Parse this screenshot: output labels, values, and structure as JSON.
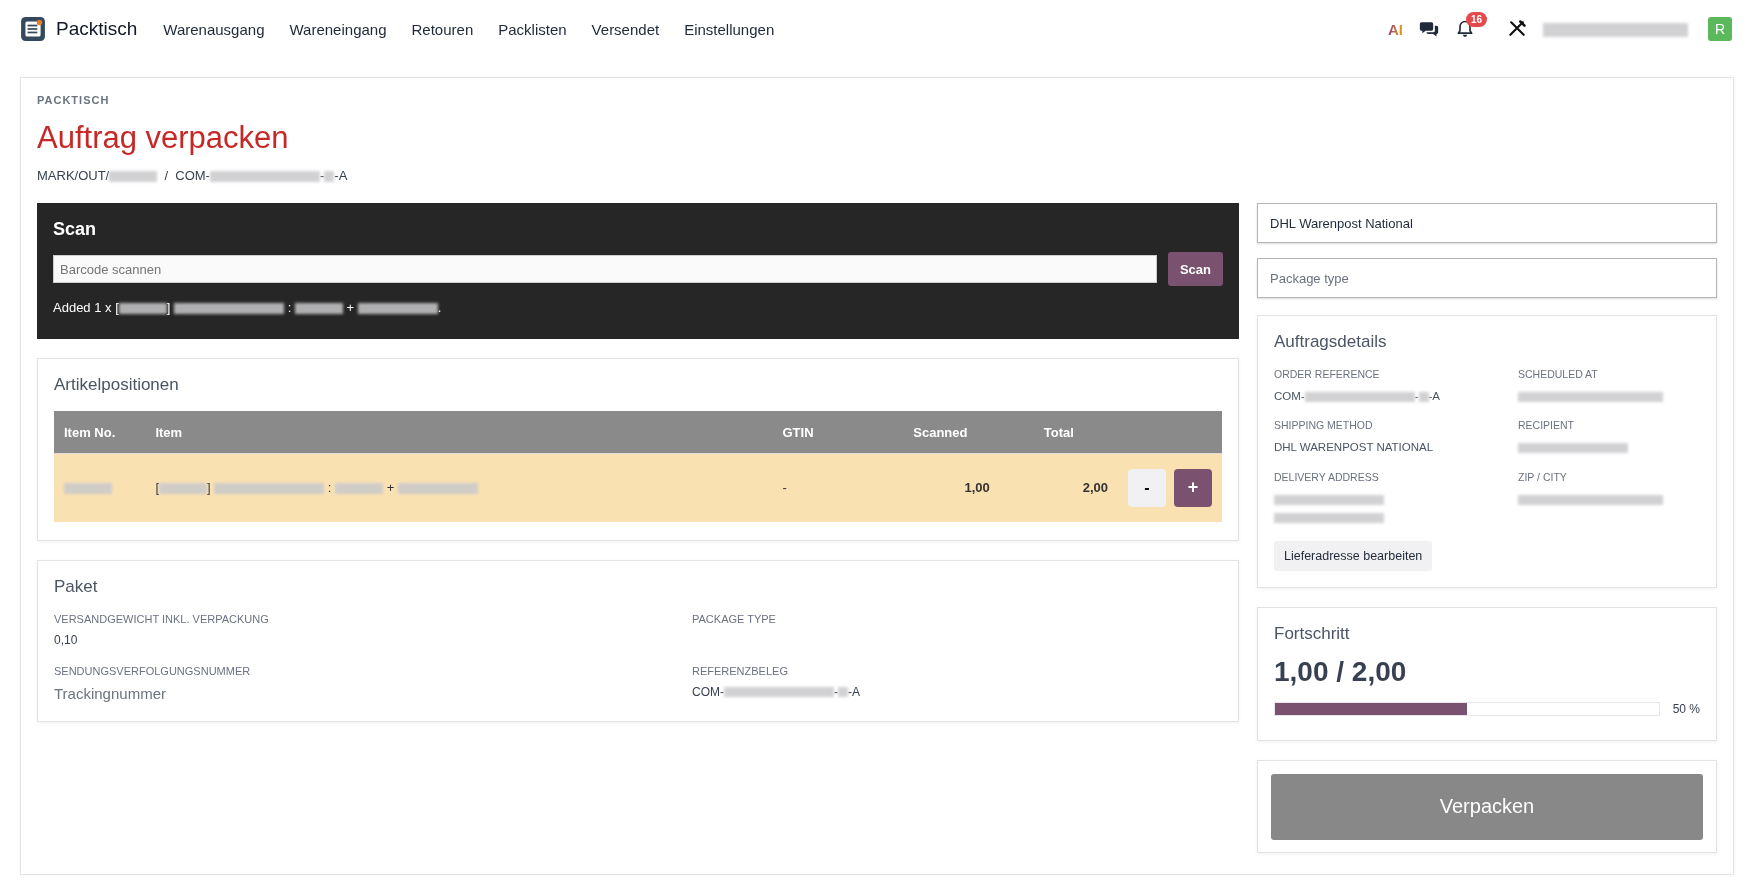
{
  "navbar": {
    "brand": "Packtisch",
    "menu": [
      "Warenausgang",
      "Wareneingang",
      "Retouren",
      "Packlisten",
      "Versendet",
      "Einstellungen"
    ],
    "ai_label": "AI",
    "notification_count": "16",
    "user_name": [
      {
        "kind": "blurwide"
      }
    ],
    "avatar_letter": "R"
  },
  "page": {
    "eyebrow": "PACKTISCH",
    "title": "Auftrag verpacken",
    "reference": [
      "MARK/OUT/",
      {
        "kind": "blurshort"
      },
      "  /  COM-",
      {
        "kind": "blurlong"
      },
      "-",
      {
        "kind": "blurtiny"
      },
      "-A"
    ]
  },
  "scan": {
    "title": "Scan",
    "placeholder": "Barcode scannen",
    "button": "Scan",
    "message": [
      "Added 1 x [",
      {
        "kind": "blurshort"
      },
      "] ",
      {
        "kind": "blurlong"
      },
      " : ",
      {
        "kind": "blurshort"
      },
      " + ",
      {
        "kind": "blurmedium"
      },
      "."
    ]
  },
  "items": {
    "title": "Artikelpositionen",
    "columns": [
      "Item No.",
      "Item",
      "GTIN",
      "Scanned",
      "Total"
    ],
    "rows": [
      {
        "item_no": [
          {
            "kind": "blurshort"
          }
        ],
        "item": [
          "[",
          {
            "kind": "blurshort"
          },
          "] ",
          {
            "kind": "blurlong"
          },
          " : ",
          {
            "kind": "blurshort"
          },
          " + ",
          {
            "kind": "blurmedium"
          }
        ],
        "gtin": "-",
        "scanned": "1,00",
        "total": "2,00",
        "decrement": "-",
        "increment": "+"
      }
    ]
  },
  "package": {
    "title": "Paket",
    "fields": [
      {
        "label": "VERSANDGEWICHT INKL. VERPACKUNG",
        "kind": "text",
        "value": [
          "0,10"
        ]
      },
      {
        "label": "PACKAGE TYPE",
        "kind": "text"
      },
      {
        "label": "SENDUNGSVERFOLGUNGSNUMMER",
        "kind": "input",
        "placeholder": "Trackingnummer"
      },
      {
        "label": "REFERENZBELEG",
        "kind": "text",
        "value": [
          "COM-",
          {
            "kind": "blurlong"
          },
          "-",
          {
            "kind": "blurtiny"
          },
          "-A"
        ]
      }
    ]
  },
  "carrier": {
    "value": "DHL Warenpost National"
  },
  "package_type": {
    "placeholder": "Package type"
  },
  "details": {
    "title": "Auftragsdetails",
    "fields": [
      {
        "label": "ORDER REFERENCE",
        "value": [
          "COM-",
          {
            "kind": "blurlong"
          },
          "-",
          {
            "kind": "blurtiny"
          },
          "-A"
        ]
      },
      {
        "label": "SCHEDULED AT",
        "value": [
          {
            "kind": "blurwide"
          }
        ]
      },
      {
        "label": "SHIPPING METHOD",
        "value": [
          "DHL WARENPOST NATIONAL"
        ]
      },
      {
        "label": "RECIPIENT",
        "value": [
          {
            "kind": "blurlong"
          }
        ]
      },
      {
        "label": "DELIVERY ADDRESS",
        "value": [
          {
            "kind": "blurlong"
          },
          {
            "kind": "newline"
          },
          {
            "kind": "blurlong"
          }
        ]
      },
      {
        "label": "ZIP / CITY",
        "value": [
          {
            "kind": "blurwide"
          }
        ]
      }
    ],
    "button": "Lieferadresse bearbeiten"
  },
  "progress": {
    "title": "Fortschritt",
    "reading": "1,00 / 2,00",
    "level": 0.5,
    "percent": "50 %"
  },
  "pack_button": {
    "label": "Verpacken",
    "disabled": true
  }
}
